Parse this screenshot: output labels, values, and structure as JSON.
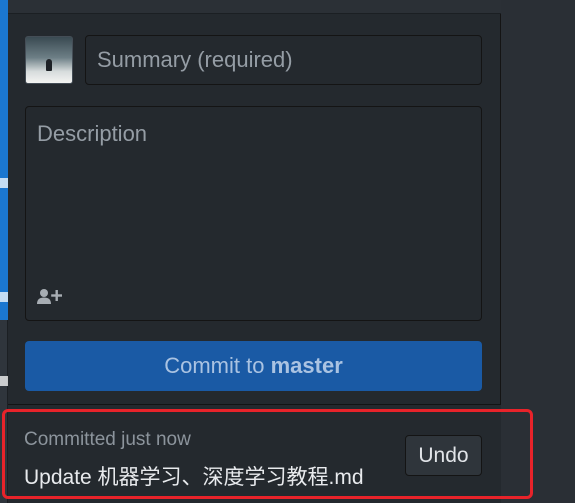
{
  "commit_form": {
    "summary_placeholder": "Summary (required)",
    "description_placeholder": "Description",
    "commit_button": {
      "prefix": "Commit to ",
      "branch": "master"
    }
  },
  "last_commit": {
    "time_text": "Committed just now",
    "message": "Update 机器学习、深度学习教程.md",
    "undo_label": "Undo"
  },
  "colors": {
    "accent": "#1a5aa5",
    "highlight": "#e8232a",
    "background": "#24292e"
  },
  "icons": {
    "coauthor": "add-coauthor-icon"
  }
}
